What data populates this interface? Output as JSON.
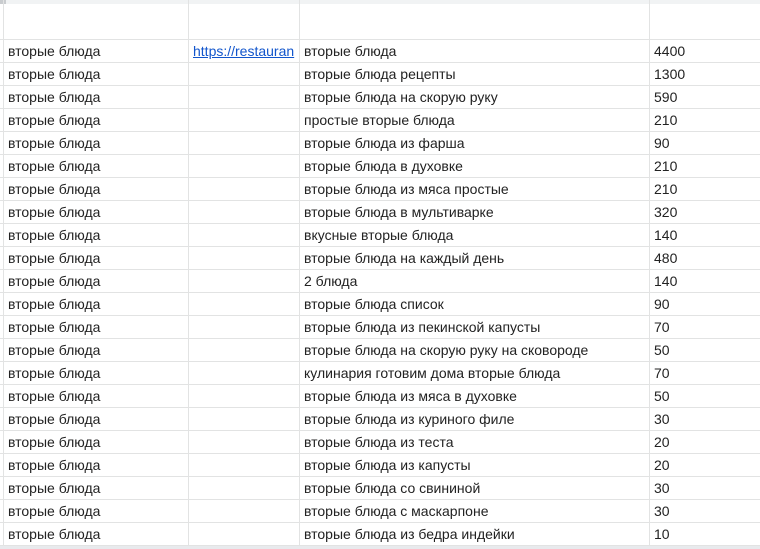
{
  "sheet": {
    "link_text": "https://restauran",
    "rows": [
      {
        "category": "вторые блюда",
        "keyword": "вторые блюда",
        "volume": "4400"
      },
      {
        "category": "вторые блюда",
        "keyword": "вторые блюда рецепты",
        "volume": "1300"
      },
      {
        "category": "вторые блюда",
        "keyword": "вторые блюда на скорую руку",
        "volume": "590"
      },
      {
        "category": "вторые блюда",
        "keyword": "простые вторые блюда",
        "volume": "210"
      },
      {
        "category": "вторые блюда",
        "keyword": "вторые блюда из фарша",
        "volume": "90"
      },
      {
        "category": "вторые блюда",
        "keyword": "вторые блюда в духовке",
        "volume": "210"
      },
      {
        "category": "вторые блюда",
        "keyword": "вторые блюда из мяса простые",
        "volume": "210"
      },
      {
        "category": "вторые блюда",
        "keyword": "вторые блюда в мультиварке",
        "volume": "320"
      },
      {
        "category": "вторые блюда",
        "keyword": "вкусные вторые блюда",
        "volume": "140"
      },
      {
        "category": "вторые блюда",
        "keyword": "вторые блюда на каждый день",
        "volume": "480"
      },
      {
        "category": "вторые блюда",
        "keyword": "2 блюда",
        "volume": "140"
      },
      {
        "category": "вторые блюда",
        "keyword": "вторые блюда список",
        "volume": "90"
      },
      {
        "category": "вторые блюда",
        "keyword": "вторые блюда из пекинской капусты",
        "volume": "70"
      },
      {
        "category": "вторые блюда",
        "keyword": "вторые блюда на скорую руку на сковороде",
        "volume": "50"
      },
      {
        "category": "вторые блюда",
        "keyword": "кулинария готовим дома вторые блюда",
        "volume": "70"
      },
      {
        "category": "вторые блюда",
        "keyword": "вторые блюда из мяса в духовке",
        "volume": "50"
      },
      {
        "category": "вторые блюда",
        "keyword": "вторые блюда из куриного филе",
        "volume": "30"
      },
      {
        "category": "вторые блюда",
        "keyword": "вторые блюда из теста",
        "volume": "20"
      },
      {
        "category": "вторые блюда",
        "keyword": "вторые блюда из капусты",
        "volume": "20"
      },
      {
        "category": "вторые блюда",
        "keyword": "вторые блюда со свининой",
        "volume": "30"
      },
      {
        "category": "вторые блюда",
        "keyword": "вторые блюда с маскарпоне",
        "volume": "30"
      },
      {
        "category": "вторые блюда",
        "keyword": "вторые блюда из бедра индейки",
        "volume": "10"
      }
    ]
  }
}
